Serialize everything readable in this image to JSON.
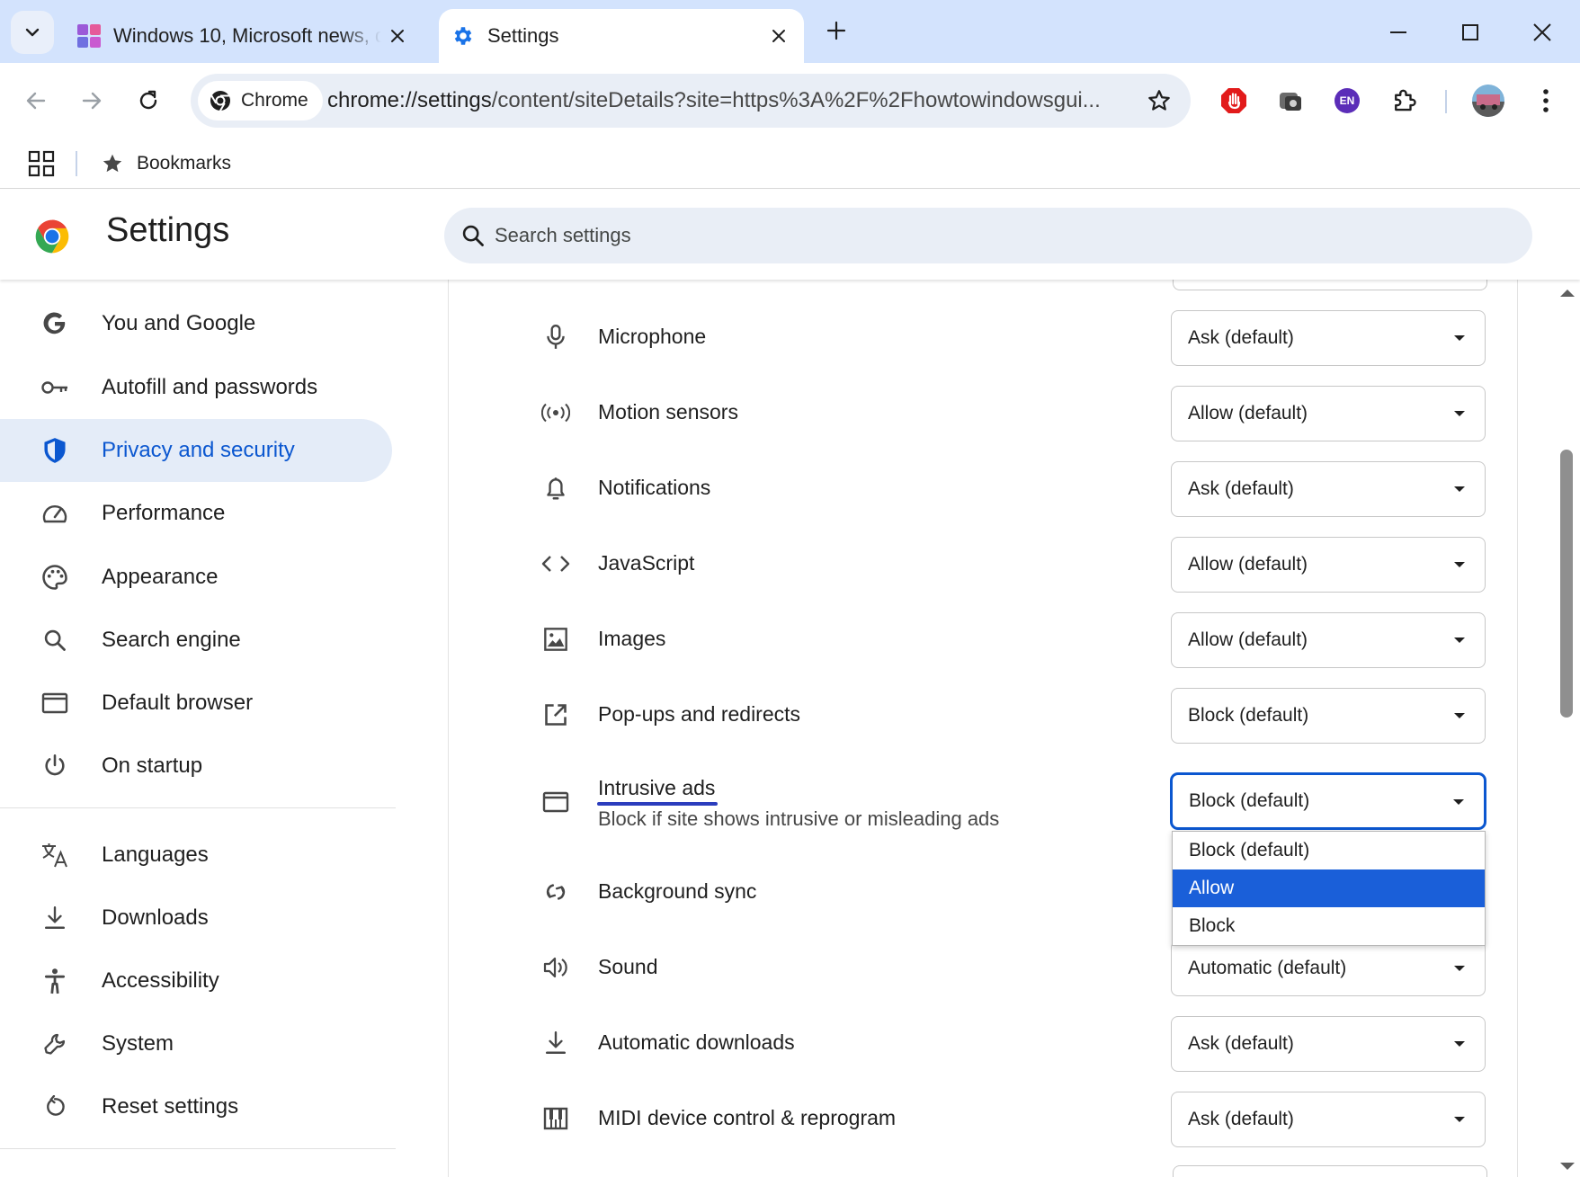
{
  "tabs": [
    {
      "title": "Windows 10, Microsoft news, de",
      "icon": "windows-news-favicon"
    },
    {
      "title": "Settings",
      "icon": "gear-icon",
      "active": true
    }
  ],
  "toolbar": {
    "chip_label": "Chrome",
    "url_host": "chrome://settings",
    "url_path": "/content/siteDetails?site=https%3A%2F%2Fhowtowindowsgui...",
    "extensions": [
      "adblock-icon",
      "screenshot-extension-icon",
      "translate-en-icon",
      "puzzle-icon"
    ],
    "translate_badge": "EN"
  },
  "bookmarks": {
    "label": "Bookmarks"
  },
  "header": {
    "title": "Settings",
    "search_placeholder": "Search settings"
  },
  "sidebar": {
    "items": [
      {
        "label": "You and Google",
        "icon": "google-g-icon"
      },
      {
        "label": "Autofill and passwords",
        "icon": "key-icon"
      },
      {
        "label": "Privacy and security",
        "icon": "shield-icon",
        "active": true
      },
      {
        "label": "Performance",
        "icon": "speedometer-icon"
      },
      {
        "label": "Appearance",
        "icon": "palette-icon"
      },
      {
        "label": "Search engine",
        "icon": "search-icon"
      },
      {
        "label": "Default browser",
        "icon": "browser-window-icon"
      },
      {
        "label": "On startup",
        "icon": "power-icon"
      },
      {
        "label": "Languages",
        "icon": "translate-icon"
      },
      {
        "label": "Downloads",
        "icon": "download-icon"
      },
      {
        "label": "Accessibility",
        "icon": "accessibility-icon"
      },
      {
        "label": "System",
        "icon": "wrench-icon"
      },
      {
        "label": "Reset settings",
        "icon": "reset-icon"
      }
    ]
  },
  "permissions": [
    {
      "label": "Microphone",
      "value": "Ask (default)",
      "icon": "microphone-icon"
    },
    {
      "label": "Motion sensors",
      "value": "Allow (default)",
      "icon": "sensors-icon"
    },
    {
      "label": "Notifications",
      "value": "Ask (default)",
      "icon": "bell-icon"
    },
    {
      "label": "JavaScript",
      "value": "Allow (default)",
      "icon": "code-icon"
    },
    {
      "label": "Images",
      "value": "Allow (default)",
      "icon": "image-icon"
    },
    {
      "label": "Pop-ups and redirects",
      "value": "Block (default)",
      "icon": "external-link-icon"
    },
    {
      "label": "Intrusive ads",
      "sub": "Block if site shows intrusive or misleading ads",
      "value": "Block (default)",
      "icon": "ads-window-icon",
      "focused": true
    },
    {
      "label": "Background sync",
      "value": "",
      "icon": "sync-icon"
    },
    {
      "label": "Sound",
      "value": "Automatic (default)",
      "icon": "speaker-icon"
    },
    {
      "label": "Automatic downloads",
      "value": "Ask (default)",
      "icon": "download-icon"
    },
    {
      "label": "MIDI device control & reprogram",
      "value": "Ask (default)",
      "icon": "piano-icon"
    }
  ],
  "dropdown": {
    "options": [
      "Block (default)",
      "Allow",
      "Block"
    ],
    "highlighted_index": 1
  },
  "colors": {
    "accent": "#0b57d0",
    "tabstrip": "#d3e3fd",
    "active_nav_bg": "#e4ecf8",
    "highlight": "#1a5fd9"
  }
}
